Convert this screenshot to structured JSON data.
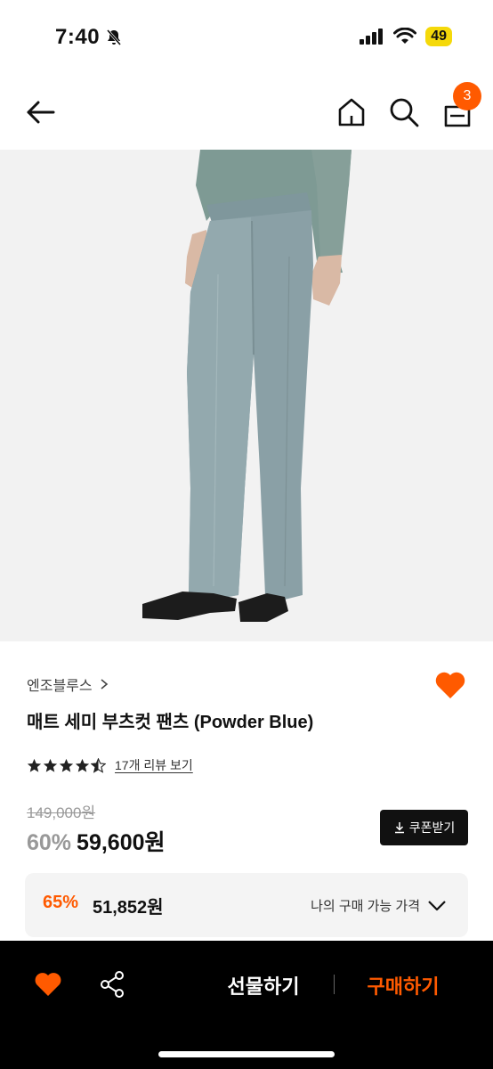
{
  "status": {
    "time": "7:40",
    "battery": "49"
  },
  "nav": {
    "cart_count": "3"
  },
  "product": {
    "brand": "엔조블루스",
    "title": "매트 세미 부츠컷 팬츠 (Powder Blue)",
    "rating": 4.5,
    "review_link": "17개 리뷰 보기",
    "original_price": "149,000원",
    "discount": "60%",
    "price": "59,600원",
    "coupon_label": "쿠폰받기"
  },
  "my_price": {
    "discount": "65%",
    "price": "51,852원",
    "label": "나의 구매 가능 가격"
  },
  "bottom_bar": {
    "gift_label": "선물하기",
    "buy_label": "구매하기"
  },
  "colors": {
    "accent": "#ff5a00",
    "dark": "#000000",
    "pants": "#8aa0a6"
  }
}
